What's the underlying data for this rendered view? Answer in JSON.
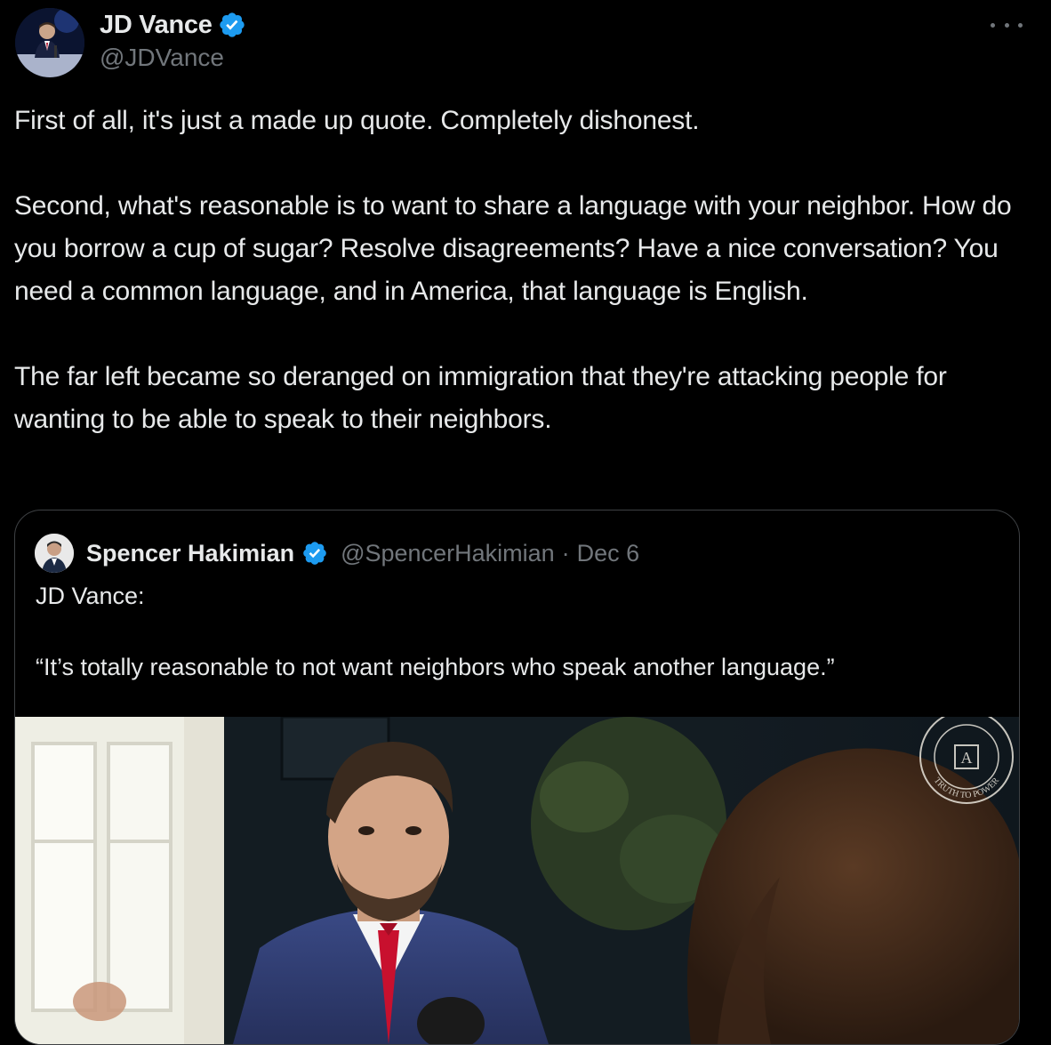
{
  "author": {
    "display_name": "JD Vance",
    "handle": "@JDVance",
    "verified": true
  },
  "tweet": {
    "paragraphs": [
      "First of all, it's just a made up quote. Completely dishonest.",
      "Second, what's reasonable is to want to share a language with your neighbor. How do you borrow a cup of sugar? Resolve disagreements? Have a nice conversation? You need a common language, and in America, that language is English.",
      "The far left became so deranged on immigration that they're attacking people for wanting to be able to speak to their neighbors."
    ]
  },
  "quote": {
    "display_name": "Spencer Hakimian",
    "handle": "@SpencerHakimian",
    "separator": "·",
    "date": "Dec 6",
    "verified": true,
    "paragraphs": [
      "JD Vance:",
      "“It’s totally reasonable to not want neighbors who speak another language.”"
    ],
    "media_watermark_text": "TRUTH TO POWER"
  },
  "colors": {
    "background": "#000000",
    "text_primary": "#e7e9ea",
    "text_secondary": "#71767b",
    "verified_badge": "#1d9bf0",
    "border": "#3e4144"
  },
  "icons": {
    "verified": "verified-badge-icon",
    "more": "more-horizontal-icon"
  }
}
